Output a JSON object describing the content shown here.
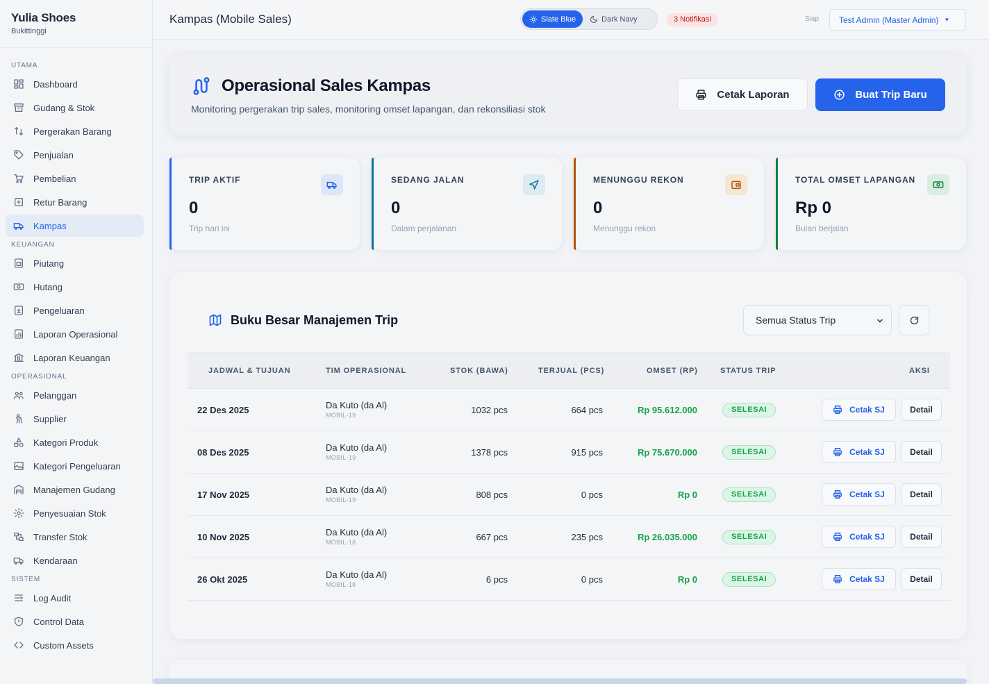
{
  "brand": {
    "name": "Yulia Shoes",
    "city": "Bukittinggi"
  },
  "sidebar": {
    "sections": [
      {
        "title": "UTAMA",
        "items": [
          {
            "label": "Dashboard",
            "icon": "dashboard-icon"
          },
          {
            "label": "Gudang & Stok",
            "icon": "archive-icon"
          },
          {
            "label": "Pergerakan Barang",
            "icon": "arrows-icon"
          },
          {
            "label": "Penjualan",
            "icon": "tag-icon"
          },
          {
            "label": "Pembelian",
            "icon": "cart-icon"
          },
          {
            "label": "Retur Barang",
            "icon": "return-icon"
          },
          {
            "label": "Kampas",
            "icon": "truck-icon",
            "active": true
          }
        ]
      },
      {
        "title": "KEUANGAN",
        "items": [
          {
            "label": "Piutang",
            "icon": "receivable-icon"
          },
          {
            "label": "Hutang",
            "icon": "money-icon"
          },
          {
            "label": "Pengeluaran",
            "icon": "expense-icon"
          },
          {
            "label": "Laporan Operasional",
            "icon": "report-icon"
          },
          {
            "label": "Laporan Keuangan",
            "icon": "bank-icon"
          }
        ]
      },
      {
        "title": "OPERASIONAL",
        "items": [
          {
            "label": "Pelanggan",
            "icon": "users-icon"
          },
          {
            "label": "Supplier",
            "icon": "supplier-icon"
          },
          {
            "label": "Kategori Produk",
            "icon": "shapes-icon"
          },
          {
            "label": "Kategori Pengeluaran",
            "icon": "image-icon"
          },
          {
            "label": "Manajemen Gudang",
            "icon": "warehouse-icon"
          },
          {
            "label": "Penyesuaian Stok",
            "icon": "gear-icon"
          },
          {
            "label": "Transfer Stok",
            "icon": "transfer-icon"
          },
          {
            "label": "Kendaraan",
            "icon": "truck-icon"
          }
        ]
      },
      {
        "title": "SISTEM",
        "items": [
          {
            "label": "Log Audit",
            "icon": "log-icon"
          },
          {
            "label": "Control Data",
            "icon": "shield-icon"
          },
          {
            "label": "Custom Assets",
            "icon": "code-icon"
          }
        ]
      }
    ]
  },
  "topbar": {
    "title": "Kampas (Mobile Sales)",
    "theme_slate": "Slate Blue",
    "theme_navy": "Dark Navy",
    "notifications": "3 Notifikasi",
    "status": "Siap",
    "user": "Test Admin (Master Admin)"
  },
  "hero": {
    "title": "Operasional Sales Kampas",
    "subtitle": "Monitoring pergerakan trip sales, monitoring omset lapangan, dan rekonsiliasi stok",
    "print_label": "Cetak Laporan",
    "new_trip_label": "Buat Trip Baru"
  },
  "stats": [
    {
      "label": "TRIP AKTIF",
      "value": "0",
      "sub": "Trip hari ini",
      "accent": "#2563eb",
      "icon_bg": "#dde6f6",
      "icon_color": "#2563eb"
    },
    {
      "label": "SEDANG JALAN",
      "value": "0",
      "sub": "Dalam perjalanan",
      "accent": "#0e6fa8",
      "icon_bg": "#dcebef",
      "icon_color": "#0e7490"
    },
    {
      "label": "MENUNGGU REKON",
      "value": "0",
      "sub": "Menunggu rekon",
      "accent": "#b45309",
      "icon_bg": "#f6e6d2",
      "icon_color": "#b45309"
    },
    {
      "label": "TOTAL OMSET LAPANGAN",
      "value": "Rp 0",
      "sub": "Bulan berjalan",
      "accent": "#15803d",
      "icon_bg": "#d9ede0",
      "icon_color": "#15803d"
    }
  ],
  "ledger": {
    "title": "Buku Besar Manajemen Trip",
    "filter_value": "Semua Status Trip",
    "columns": [
      "JADWAL & TUJUAN",
      "TIM OPERASIONAL",
      "STOK (BAWA)",
      "TERJUAL (PCS)",
      "OMSET (RP)",
      "STATUS TRIP",
      "AKSI"
    ],
    "rows": [
      {
        "date": "22 Des 2025",
        "team": "Da Kuto (da Al)",
        "vehicle": "MOBIL-19",
        "stock": "1032 pcs",
        "sold": "664 pcs",
        "omset": "Rp 95.612.000",
        "status": "SELESAI",
        "sj": "Cetak SJ",
        "detail": "Detail"
      },
      {
        "date": "08 Des 2025",
        "team": "Da Kuto (da Al)",
        "vehicle": "MOBIL-19",
        "stock": "1378 pcs",
        "sold": "915 pcs",
        "omset": "Rp 75.670.000",
        "status": "SELESAI",
        "sj": "Cetak SJ",
        "detail": "Detail"
      },
      {
        "date": "17 Nov 2025",
        "team": "Da Kuto (da Al)",
        "vehicle": "MOBIL-19",
        "stock": "808 pcs",
        "sold": "0 pcs",
        "omset": "Rp 0",
        "status": "SELESAI",
        "sj": "Cetak SJ",
        "detail": "Detail"
      },
      {
        "date": "10 Nov 2025",
        "team": "Da Kuto (da Al)",
        "vehicle": "MOBIL-18",
        "stock": "667 pcs",
        "sold": "235 pcs",
        "omset": "Rp 26.035.000",
        "status": "SELESAI",
        "sj": "Cetak SJ",
        "detail": "Detail"
      },
      {
        "date": "26 Okt 2025",
        "team": "Da Kuto (da Al)",
        "vehicle": "MOBIL-18",
        "stock": "6 pcs",
        "sold": "0 pcs",
        "omset": "Rp 0",
        "status": "SELESAI",
        "sj": "Cetak SJ",
        "detail": "Detail"
      }
    ]
  }
}
